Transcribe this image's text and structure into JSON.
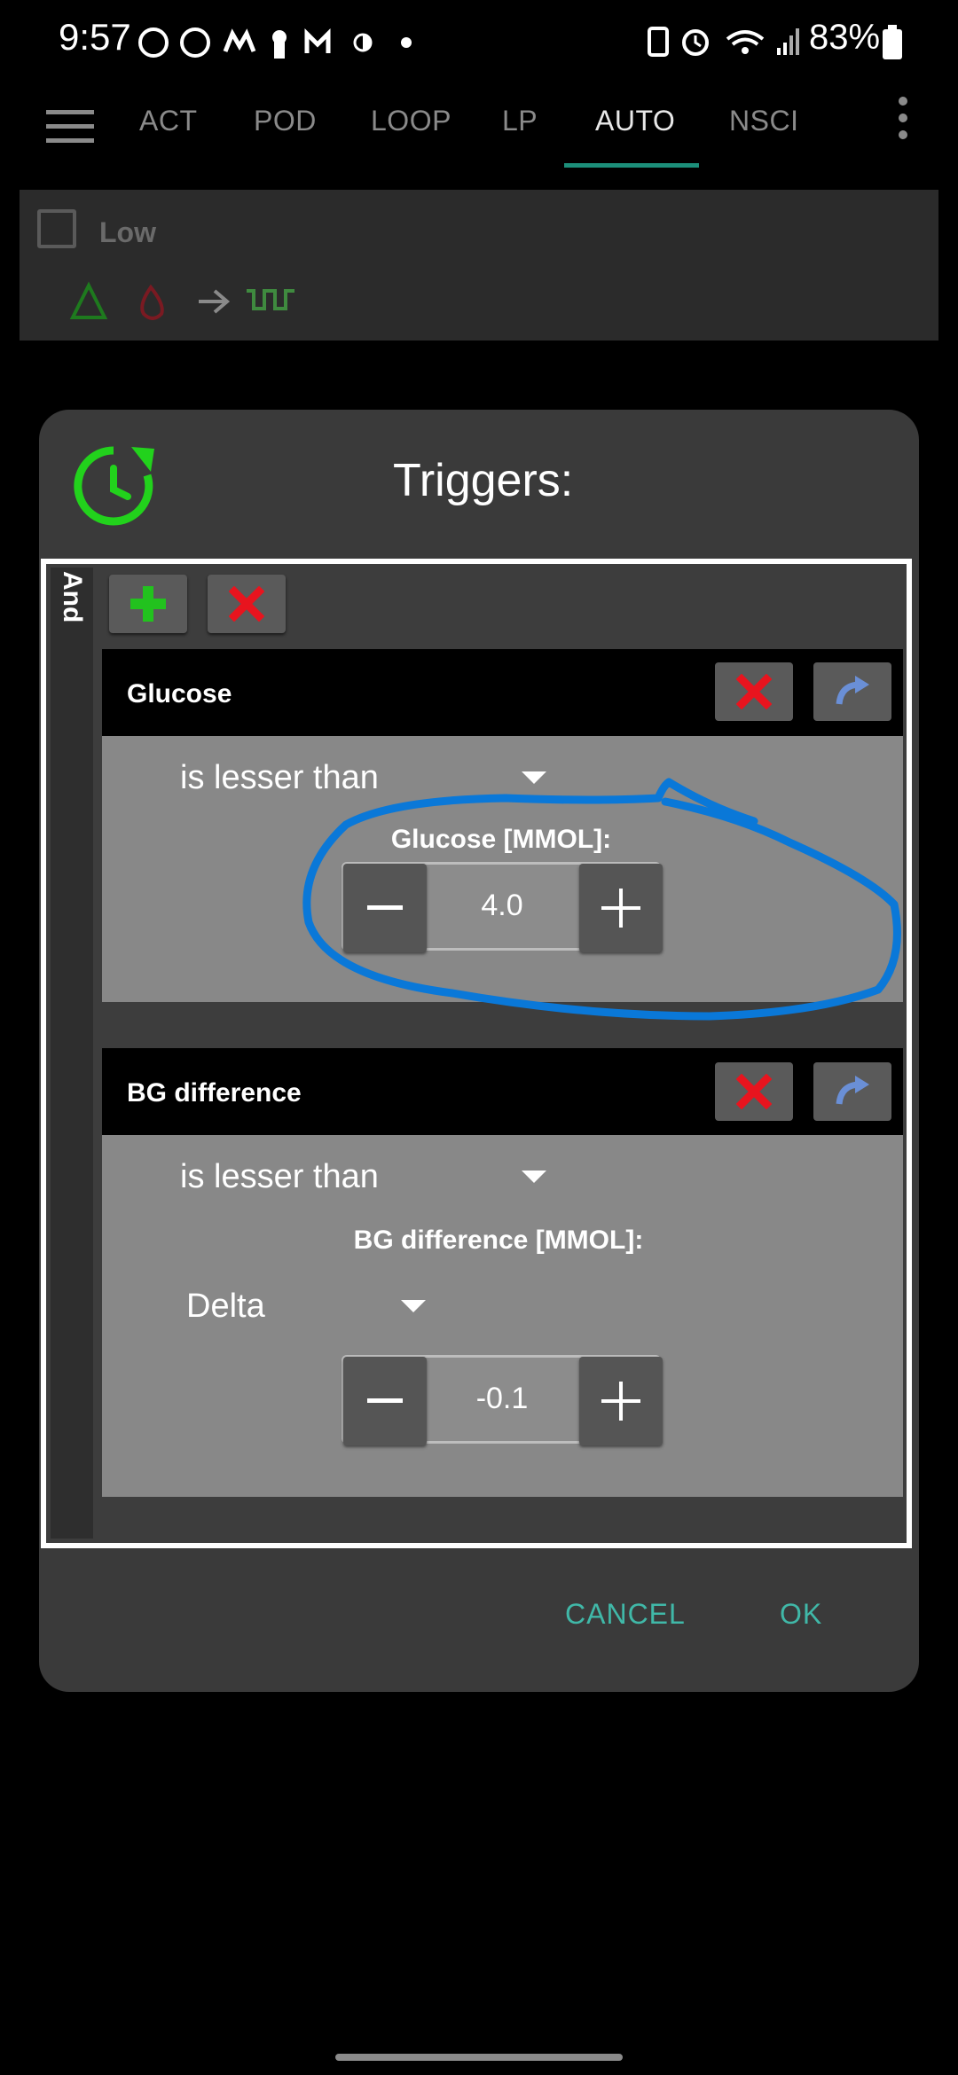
{
  "status_bar": {
    "time": "9:57",
    "battery_percent": "83%"
  },
  "app_bar": {
    "tabs": [
      {
        "label": "ACT"
      },
      {
        "label": "POD"
      },
      {
        "label": "LOOP"
      },
      {
        "label": "LP"
      },
      {
        "label": "AUTO",
        "active": true
      },
      {
        "label": "NSCI"
      }
    ],
    "accent_color": "#1c8f7a"
  },
  "background_item": {
    "label": "Low",
    "checked": false
  },
  "dialog": {
    "title": "Triggers:",
    "connector_label": "And",
    "triggers": [
      {
        "title": "Glucose",
        "comparator": "is lesser than",
        "field_label": "Glucose [MMOL]:",
        "value": "4.0"
      },
      {
        "title": "BG difference",
        "comparator": "is lesser than",
        "field_label": "BG difference [MMOL]:",
        "type_select": "Delta",
        "value": "-0.1"
      }
    ],
    "cancel_label": "CANCEL",
    "ok_label": "OK"
  },
  "colors": {
    "dialog_bg": "#3a3a3a",
    "trigger_body": "#888888",
    "add_green": "#22c21e",
    "remove_red": "#e8141e",
    "clone_blue": "#6a8fd6",
    "annotation_blue": "#0a78d8"
  }
}
